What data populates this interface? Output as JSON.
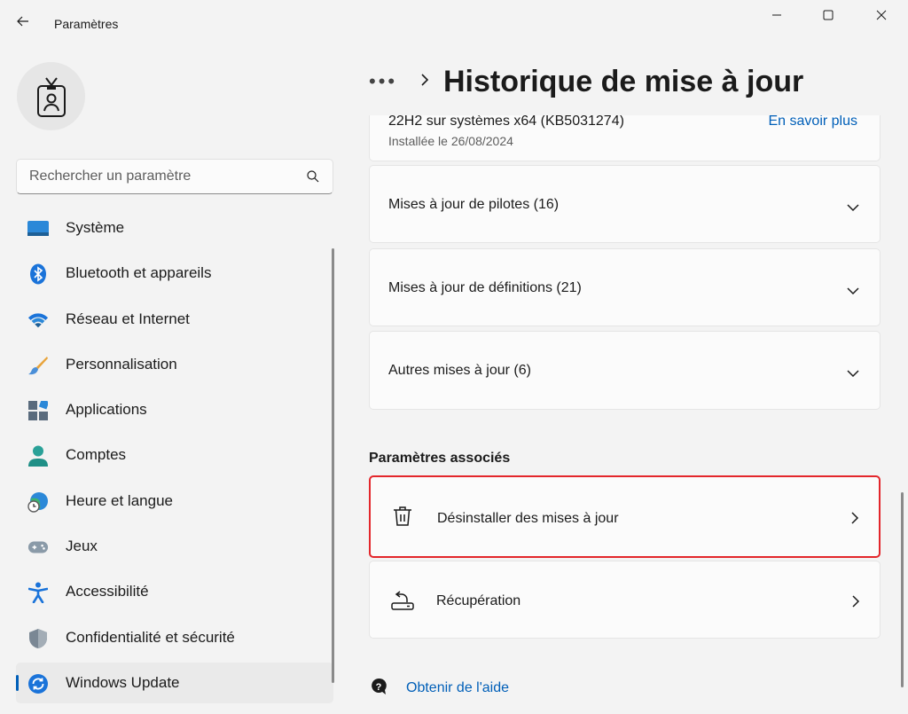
{
  "window": {
    "title": "Paramètres"
  },
  "search": {
    "placeholder": "Rechercher un paramètre"
  },
  "sidebar": {
    "items": [
      {
        "label": "Système",
        "icon": "monitor-icon"
      },
      {
        "label": "Bluetooth et appareils",
        "icon": "bluetooth-icon"
      },
      {
        "label": "Réseau et Internet",
        "icon": "wifi-icon"
      },
      {
        "label": "Personnalisation",
        "icon": "brush-icon"
      },
      {
        "label": "Applications",
        "icon": "apps-icon"
      },
      {
        "label": "Comptes",
        "icon": "person-icon"
      },
      {
        "label": "Heure et langue",
        "icon": "globe-clock-icon"
      },
      {
        "label": "Jeux",
        "icon": "gamepad-icon"
      },
      {
        "label": "Accessibilité",
        "icon": "accessibility-icon"
      },
      {
        "label": "Confidentialité et sécurité",
        "icon": "shield-icon"
      },
      {
        "label": "Windows Update",
        "icon": "update-icon",
        "active": true
      }
    ]
  },
  "header": {
    "breadcrumb_more": "•••",
    "title": "Historique de mise à jour"
  },
  "partial_update": {
    "name": "22H2 sur systèmes x64 (KB5031274)",
    "installed": "Installée le 26/08/2024",
    "link": "En savoir plus"
  },
  "categories": [
    {
      "label": "Mises à jour de pilotes (16)"
    },
    {
      "label": "Mises à jour de définitions (21)"
    },
    {
      "label": "Autres mises à jour (6)"
    }
  ],
  "related": {
    "title": "Paramètres associés",
    "uninstall": "Désinstaller des mises à jour",
    "recovery": "Récupération"
  },
  "help": {
    "label": "Obtenir de l'aide"
  },
  "colors": {
    "accent": "#005fb8",
    "highlight": "#e3262b"
  }
}
